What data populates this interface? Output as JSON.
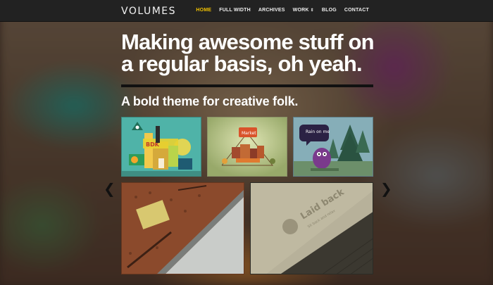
{
  "site": {
    "logo": "VOLUMES"
  },
  "nav": [
    {
      "label": "HOME",
      "active": true
    },
    {
      "label": "FULL WIDTH"
    },
    {
      "label": "ARCHIVES"
    },
    {
      "label": "WORK",
      "has_dropdown": true
    },
    {
      "label": "BLOG"
    },
    {
      "label": "CONTACT"
    }
  ],
  "hero": {
    "headline_line1": "Making awesome stuff on",
    "headline_line2": "a regular basis, oh yeah.",
    "tagline": "A bold theme for creative folk."
  },
  "thumbnails": {
    "speech_bubble_text": "Rain on me",
    "sign_text": "Market",
    "building_text": "BDK",
    "card_text_1": "Laid back",
    "card_text_2": "Sit back and relax"
  },
  "colors": {
    "topbar": "#222222",
    "nav_active": "#f2c200",
    "accent_rule": "#111111"
  },
  "icons": {
    "prev": "chevron-left-icon",
    "next": "chevron-right-icon",
    "dropdown": "chevron-down-icon"
  }
}
